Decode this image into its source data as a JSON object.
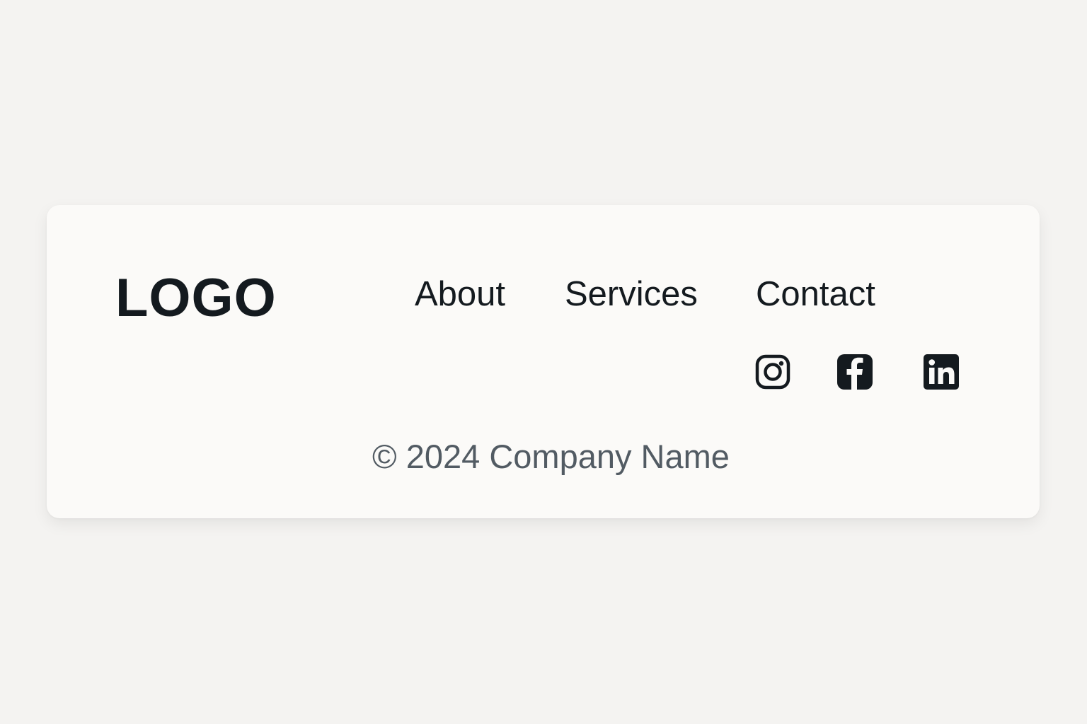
{
  "footer": {
    "logo_text": "LOGO",
    "nav": {
      "about": "About",
      "services": "Services",
      "contact": "Contact"
    },
    "social": [
      {
        "name": "instagram",
        "icon": "instagram-icon"
      },
      {
        "name": "facebook",
        "icon": "facebook-icon"
      },
      {
        "name": "linkedin",
        "icon": "linkedin-icon"
      }
    ],
    "copyright": "© 2024 Company Name"
  },
  "colors": {
    "background": "#f4f3f1",
    "card": "#fbfaf8",
    "text_primary": "#141a1f",
    "text_muted": "#525b63"
  }
}
